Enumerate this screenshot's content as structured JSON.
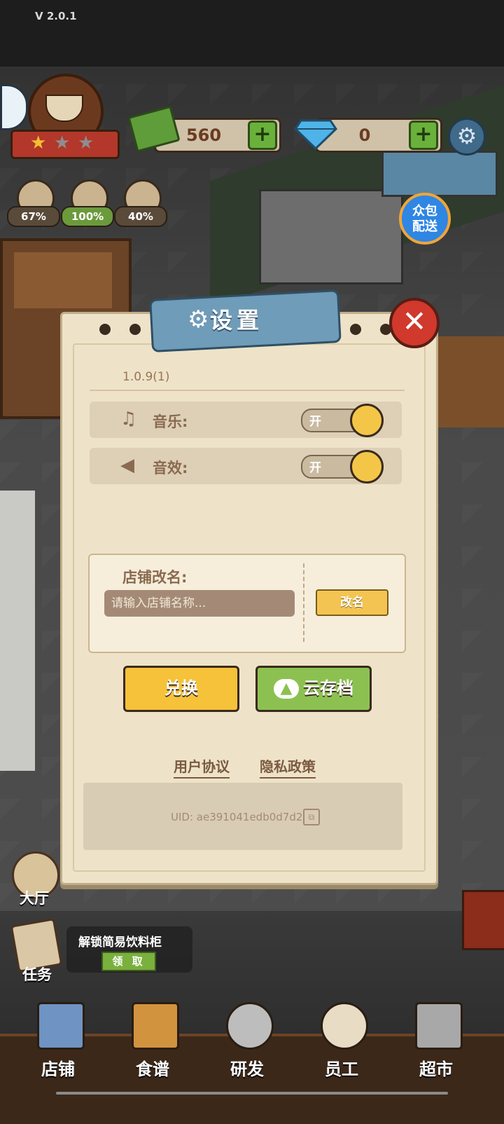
{
  "app": {
    "version": "V 2.0.1"
  },
  "hud": {
    "rating_stars": 1,
    "rating_max": 3,
    "stats": [
      {
        "icon": "chair-icon",
        "value": "67%"
      },
      {
        "icon": "food-cover-icon",
        "value": "100%"
      },
      {
        "icon": "noodle-bowl-icon",
        "value": "40%"
      }
    ],
    "cash": "560",
    "gems": "0",
    "delivery_label": "众包\n配送"
  },
  "settings": {
    "title": "设置",
    "build_version": "1.0.9(1)",
    "music_label": "音乐:",
    "music_state": "开",
    "sfx_label": "音效:",
    "sfx_state": "开",
    "rename_label": "店铺改名:",
    "rename_placeholder": "请输入店铺名称...",
    "rename_button": "改名",
    "exchange_button": "兑换",
    "cloud_save_button": "云存档",
    "user_agreement": "用户协议",
    "privacy_policy": "隐私政策",
    "uid": "UID: ae391041edb0d7d2"
  },
  "side": {
    "hall_label": "大厅",
    "task_label": "任务",
    "task_text": "解锁简易饮料柜",
    "claim_button": "领 取"
  },
  "nav": {
    "items": [
      {
        "label": "店铺"
      },
      {
        "label": "食谱"
      },
      {
        "label": "研发"
      },
      {
        "label": "员工"
      },
      {
        "label": "超市"
      }
    ]
  },
  "colors": {
    "panel_bg": "#eee3c8",
    "title_ribbon": "#6f9cb8",
    "close_red": "#d0392b",
    "toggle_knob": "#f4c648",
    "exchange_yellow": "#f5c23a",
    "cloud_green": "#8cc152",
    "delivery_blue": "#2f86e3"
  }
}
